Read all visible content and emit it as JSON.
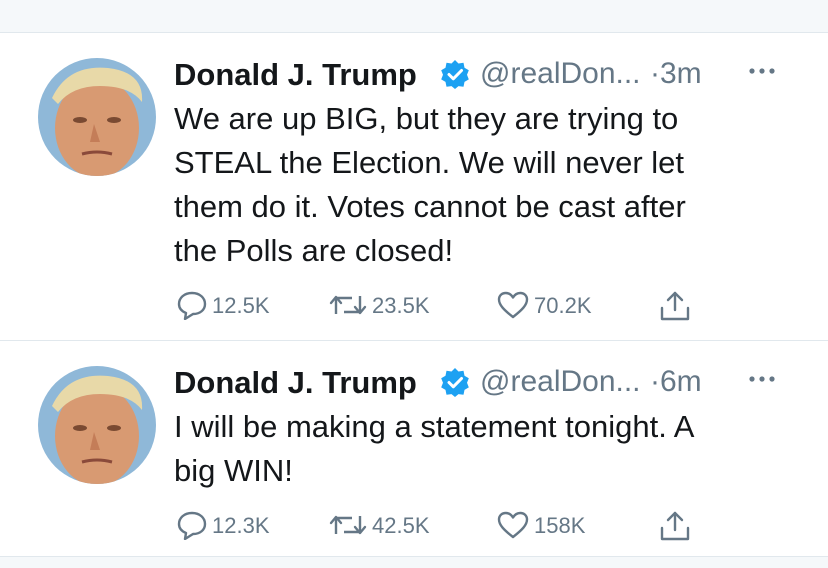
{
  "tweets": [
    {
      "author": "Donald J. Trump",
      "handle": "@realDon...",
      "time": "·3m",
      "text_lines": [
        "We are up BIG, but they are trying to",
        "STEAL the Election. We will never let",
        "them do it. Votes cannot be cast after",
        "the Polls are closed!"
      ],
      "replies": "12.5K",
      "retweets": "23.5K",
      "likes": "70.2K"
    },
    {
      "author": "Donald J. Trump",
      "handle": "@realDon...",
      "time": "·6m",
      "text_lines": [
        "I will be making a statement tonight. A",
        "big WIN!"
      ],
      "replies": "12.3K",
      "retweets": "42.5K",
      "likes": "158K"
    }
  ],
  "icons": {
    "verified": "verified-badge-icon",
    "more": "more-dots-icon",
    "reply": "reply-bubble-icon",
    "retweet": "retweet-arrows-icon",
    "like": "heart-icon",
    "share": "share-upload-icon"
  },
  "colors": {
    "verified_blue": "#1da1f2",
    "muted_text": "#657786",
    "primary_text": "#14171a",
    "divider": "#e1e8ed"
  }
}
